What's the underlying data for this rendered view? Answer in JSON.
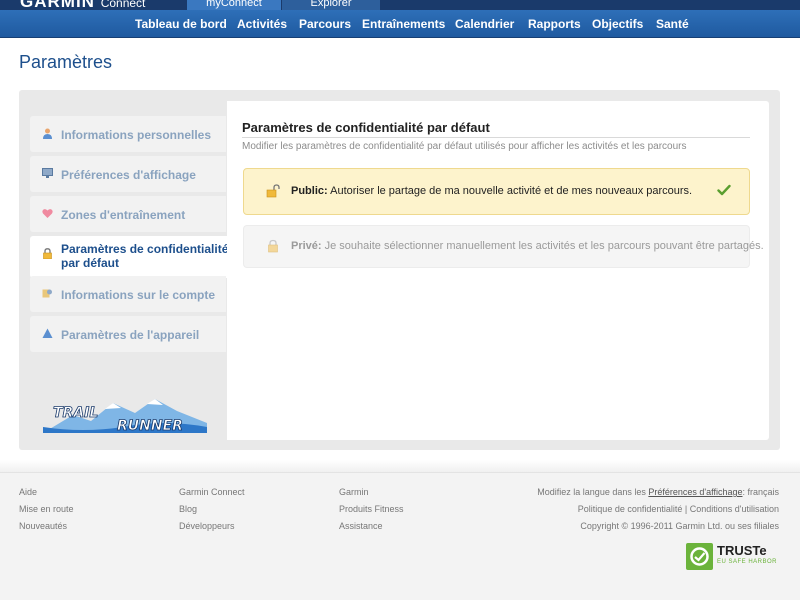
{
  "header": {
    "logo": "GARMIN",
    "logo_sub": "Connect",
    "tabs": [
      "myConnect",
      "Explorer"
    ]
  },
  "nav": {
    "items": [
      "Tableau de bord",
      "Activités",
      "Parcours",
      "Entraînements",
      "Calendrier",
      "Rapports",
      "Objectifs",
      "Santé"
    ]
  },
  "page": {
    "title": "Paramètres"
  },
  "sidebar": {
    "items": [
      {
        "label": "Informations personnelles",
        "icon": "user-icon"
      },
      {
        "label": "Préférences d'affichage",
        "icon": "monitor-icon"
      },
      {
        "label": "Zones d'entraînement",
        "icon": "heart-icon"
      },
      {
        "label": "Paramètres de confidentialité par défaut",
        "icon": "lock-icon"
      },
      {
        "label": "Informations sur le compte",
        "icon": "account-icon"
      },
      {
        "label": "Paramètres de l'appareil",
        "icon": "device-icon"
      }
    ],
    "active_index": 3,
    "promo_logo": "TRAIL RUNNER"
  },
  "content": {
    "title": "Paramètres de confidentialité par défaut",
    "subtitle": "Modifier les paramètres de confidentialité par défaut utilisés pour afficher les activités et les parcours",
    "options": [
      {
        "label": "Public:",
        "text": " Autoriser le partage de ma nouvelle activité et de mes nouveaux parcours.",
        "selected": true
      },
      {
        "label": "Privé:",
        "text": " Je souhaite sélectionner manuellement les activités et les parcours pouvant être partagés.",
        "selected": false
      }
    ]
  },
  "footer": {
    "col1": [
      "Aide",
      "Mise en route",
      "Nouveautés"
    ],
    "col2": [
      "Garmin Connect",
      "Blog",
      "Développeurs"
    ],
    "col3": [
      "Garmin",
      "Produits Fitness",
      "Assistance"
    ],
    "lang_prefix": "Modifiez la langue dans les ",
    "lang_link": "Préférences d'affichage",
    "lang_suffix": ": français",
    "privacy_link": "Politique de confidentialité",
    "sep": " | ",
    "terms_link": "Conditions d'utilisation",
    "copyright": "Copyright © 1996-2011 Garmin Ltd. ou ses filiales",
    "truste_name": "TRUSTe",
    "truste_sub": "EU SAFE HARBOR"
  },
  "colors": {
    "brand_dark": "#1a3a6b",
    "nav_blue": "#2e6fb8",
    "title_blue": "#1d4f8c",
    "selected_bg": "#fdf3cc",
    "check_green": "#5a9e2f"
  }
}
